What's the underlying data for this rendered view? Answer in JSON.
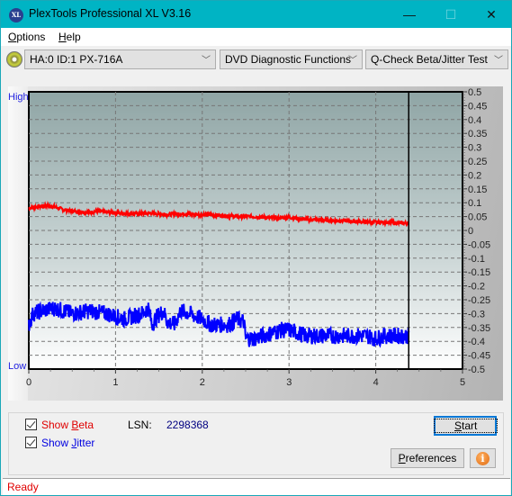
{
  "window": {
    "title": "PlexTools Professional XL V3.16",
    "app_icon": "XL",
    "controls": {
      "minimize": "—",
      "maximize": "☐",
      "close": "✕"
    }
  },
  "menu": [
    {
      "label": "Options",
      "accel": "O",
      "rest": "ptions"
    },
    {
      "label": "Help",
      "accel": "H",
      "rest": "elp"
    }
  ],
  "toolbar": {
    "drive": "HA:0 ID:1  PX-716A",
    "function": "DVD Diagnostic Functions",
    "test": "Q-Check Beta/Jitter Test",
    "arrow": "﹀"
  },
  "chart": {
    "high_label": "High",
    "low_label": "Low"
  },
  "chart_data": {
    "type": "line",
    "title": "",
    "xlabel": "",
    "ylabel": "",
    "xlim": [
      0,
      5
    ],
    "ylim": [
      -0.5,
      0.5
    ],
    "x_ticks": [
      "0",
      "1",
      "2",
      "3",
      "4",
      "5"
    ],
    "y_ticks": [
      "0.5",
      "0.45",
      "0.4",
      "0.35",
      "0.3",
      "0.25",
      "0.2",
      "0.15",
      "0.1",
      "0.05",
      "0",
      "-0.05",
      "-0.1",
      "-0.15",
      "-0.2",
      "-0.25",
      "-0.3",
      "-0.35",
      "-0.4",
      "-0.45",
      "-0.5"
    ],
    "grid": true,
    "marker_x": 4.38,
    "series": [
      {
        "name": "Beta",
        "color": "#ff0000",
        "x": [
          0,
          0.1,
          0.2,
          0.3,
          0.4,
          0.5,
          0.6,
          0.7,
          0.8,
          0.9,
          1.0,
          1.2,
          1.4,
          1.6,
          1.8,
          2.0,
          2.2,
          2.4,
          2.6,
          2.8,
          3.0,
          3.2,
          3.4,
          3.6,
          3.8,
          4.0,
          4.2,
          4.38
        ],
        "y": [
          0.08,
          0.085,
          0.09,
          0.085,
          0.075,
          0.07,
          0.068,
          0.065,
          0.07,
          0.066,
          0.063,
          0.06,
          0.062,
          0.058,
          0.06,
          0.057,
          0.055,
          0.05,
          0.05,
          0.045,
          0.047,
          0.04,
          0.037,
          0.035,
          0.032,
          0.03,
          0.028,
          0.025
        ],
        "noise": 0.006
      },
      {
        "name": "Jitter",
        "color": "#0000ff",
        "x": [
          0,
          0.05,
          0.15,
          0.3,
          0.5,
          0.7,
          0.9,
          1.0,
          1.1,
          1.3,
          1.38,
          1.42,
          1.48,
          1.55,
          1.6,
          1.68,
          1.75,
          1.85,
          2.0,
          2.1,
          2.2,
          2.3,
          2.4,
          2.48,
          2.5,
          2.6,
          2.7,
          2.8,
          2.9,
          3.0,
          3.1,
          3.2,
          3.3,
          3.5,
          3.7,
          3.9,
          4.0,
          4.1,
          4.2,
          4.3,
          4.38
        ],
        "y": [
          -0.34,
          -0.3,
          -0.29,
          -0.28,
          -0.3,
          -0.29,
          -0.3,
          -0.31,
          -0.32,
          -0.3,
          -0.28,
          -0.34,
          -0.31,
          -0.29,
          -0.33,
          -0.34,
          -0.29,
          -0.3,
          -0.32,
          -0.34,
          -0.34,
          -0.34,
          -0.32,
          -0.33,
          -0.39,
          -0.39,
          -0.38,
          -0.37,
          -0.36,
          -0.36,
          -0.37,
          -0.38,
          -0.38,
          -0.38,
          -0.38,
          -0.38,
          -0.39,
          -0.38,
          -0.38,
          -0.38,
          -0.38
        ],
        "noise": 0.03
      }
    ]
  },
  "controls": {
    "show_beta": {
      "label_pre": "Show ",
      "accel": "B",
      "label_post": "eta",
      "checked": true,
      "color": "#e00000"
    },
    "show_jitter": {
      "label_pre": "Show ",
      "accel": "J",
      "label_post": "itter",
      "checked": true,
      "color": "#0000e0"
    },
    "lsn_label": "LSN:",
    "lsn_value": "2298368",
    "start": {
      "accel": "S",
      "rest": "tart"
    },
    "preferences": {
      "accel": "P",
      "rest": "references"
    },
    "info_icon": "i"
  },
  "status": {
    "text": "Ready"
  }
}
